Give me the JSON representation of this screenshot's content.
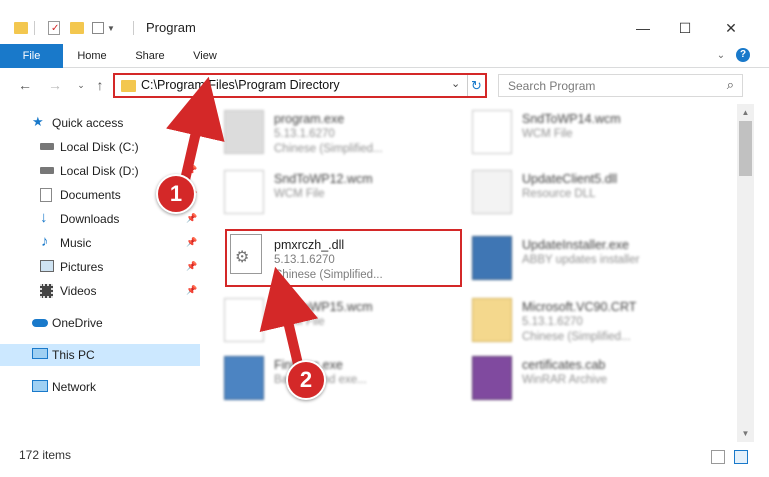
{
  "window": {
    "title": "Program",
    "minimize_icon": "minimize-icon",
    "maximize_icon": "maximize-icon",
    "close_icon": "close-icon"
  },
  "ribbon": {
    "tabs": [
      {
        "label": "File"
      },
      {
        "label": "Home"
      },
      {
        "label": "Share"
      },
      {
        "label": "View"
      }
    ]
  },
  "address": {
    "path": "C:\\Program Files\\Program Directory"
  },
  "search": {
    "placeholder": "Search Program"
  },
  "nav": {
    "items": [
      {
        "label": "Quick access",
        "icon": "star-icon"
      },
      {
        "label": "Local Disk (C:)",
        "icon": "drive-icon"
      },
      {
        "label": "Local Disk (D:)",
        "icon": "drive-icon"
      },
      {
        "label": "Documents",
        "icon": "documents-icon"
      },
      {
        "label": "Downloads",
        "icon": "download-icon"
      },
      {
        "label": "Music",
        "icon": "music-icon"
      },
      {
        "label": "Pictures",
        "icon": "pictures-icon"
      },
      {
        "label": "Videos",
        "icon": "videos-icon"
      },
      {
        "label": "OneDrive",
        "icon": "cloud-icon"
      },
      {
        "label": "This PC",
        "icon": "computer-icon"
      },
      {
        "label": "Network",
        "icon": "network-icon"
      }
    ]
  },
  "files": [
    {
      "name": "program.exe",
      "line2": "5.13.1.6270",
      "line3": "Chinese (Simplified..."
    },
    {
      "name": "SndToWP14.wcm",
      "line2": "WCM File",
      "line3": ""
    },
    {
      "name": "SndToWP12.wcm",
      "line2": "WCM File",
      "line3": ""
    },
    {
      "name": "UpdateClient5.dll",
      "line2": "Resource DLL",
      "line3": ""
    },
    {
      "name": "pmxrczh_.dll",
      "line2": "5.13.1.6270",
      "line3": "Chinese (Simplified..."
    },
    {
      "name": "UpdateInstaller.exe",
      "line2": "ABBY updates installer",
      "line3": ""
    },
    {
      "name": "SndToWP15.wcm",
      "line2": "WCM File",
      "line3": ""
    },
    {
      "name": "Microsoft.VC90.CRT",
      "line2": "5.13.1.6270",
      "line3": "Chinese (Simplified..."
    },
    {
      "name": "FinExec.exe",
      "line2": "Background exe...",
      "line3": ""
    },
    {
      "name": "certificates.cab",
      "line2": "WinRAR Archive",
      "line3": ""
    }
  ],
  "status": {
    "count": "172 items"
  },
  "callouts": {
    "one": "1",
    "two": "2"
  },
  "colors": {
    "accent": "#1979ca",
    "highlight": "#d42828",
    "selection": "#cce8ff"
  }
}
